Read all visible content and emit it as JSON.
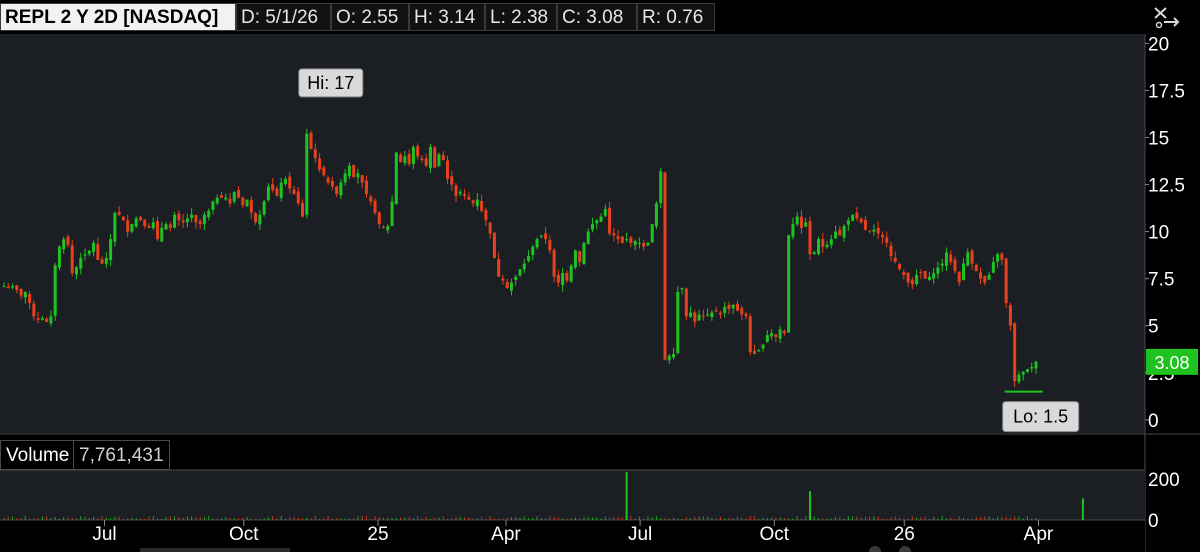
{
  "header": {
    "symbol": "REPL 2 Y 2D [NASDAQ]",
    "date": "D: 5/1/26",
    "open": "O: 2.55",
    "high": "H: 3.14",
    "low": "L: 2.38",
    "close": "C: 3.08",
    "range": "R: 0.76",
    "tool_icon": "scissors-cursor-icon"
  },
  "volume_panel": {
    "label": "Volume",
    "value": "7,761,431",
    "axis_ticks": [
      "200",
      "0"
    ]
  },
  "price_tag": {
    "value": "3.08",
    "color": "#1fc31f"
  },
  "colors": {
    "up": "#1fc31f",
    "down": "#e8401c",
    "background": "#1b1f24",
    "panel_bg": "#000000"
  },
  "chart_data": {
    "type": "candlestick",
    "price_axis": {
      "ticks": [
        "20",
        "17.5",
        "15",
        "12.5",
        "10",
        "7.5",
        "5",
        "2.5",
        "0"
      ],
      "ylim": [
        -0.7,
        20.5
      ]
    },
    "time_axis": {
      "ticks": [
        "Jul",
        "Oct",
        "25",
        "Apr",
        "Jul",
        "Oct",
        "26",
        "Apr"
      ]
    },
    "annotations": [
      {
        "label": "Hi: 17",
        "value": 17
      },
      {
        "label": "Lo: 1.5",
        "value": 1.5
      }
    ],
    "last_price": 3.08,
    "close_series": [
      7.1,
      7.0,
      7.1,
      6.9,
      6.6,
      6.8,
      6.2,
      5.5,
      5.3,
      5.4,
      5.2,
      5.5,
      8.2,
      9.2,
      9.6,
      9.3,
      7.8,
      8.1,
      8.6,
      8.8,
      9.0,
      9.4,
      8.5,
      8.3,
      8.6,
      9.6,
      11.0,
      10.9,
      10.6,
      10.0,
      10.4,
      10.7,
      10.6,
      10.3,
      10.2,
      10.5,
      9.6,
      10.2,
      10.4,
      10.2,
      10.9,
      10.6,
      10.5,
      10.7,
      10.9,
      10.5,
      10.4,
      10.9,
      11.1,
      11.6,
      11.8,
      11.8,
      11.8,
      11.5,
      12.1,
      11.8,
      11.4,
      11.7,
      11.0,
      10.5,
      10.9,
      11.6,
      12.4,
      12.2,
      11.9,
      12.6,
      12.8,
      12.3,
      12.0,
      11.5,
      10.8,
      15.2,
      14.4,
      13.9,
      13.3,
      13.0,
      12.6,
      12.4,
      12.0,
      12.6,
      13.1,
      13.5,
      12.9,
      13.1,
      12.6,
      12.0,
      11.6,
      11.0,
      10.4,
      10.2,
      10.3,
      11.6,
      14.2,
      13.7,
      14.0,
      13.6,
      14.5,
      14.0,
      13.8,
      13.5,
      14.5,
      13.4,
      14.1,
      13.8,
      12.8,
      12.5,
      11.9,
      12.1,
      11.9,
      11.7,
      11.5,
      11.7,
      11.1,
      10.6,
      9.9,
      8.6,
      7.6,
      7.4,
      7.0,
      7.3,
      7.6,
      8.0,
      8.3,
      8.7,
      9.2,
      9.6,
      9.8,
      9.6,
      9.0,
      7.6,
      7.3,
      7.8,
      7.4,
      8.2,
      9.0,
      8.4,
      9.4,
      10.0,
      10.4,
      10.6,
      10.8,
      11.2,
      9.9,
      9.8,
      9.6,
      9.4,
      9.6,
      9.4,
      9.5,
      9.4,
      9.2,
      9.4,
      10.4,
      11.5,
      13.2,
      3.2,
      3.4,
      3.5,
      6.8,
      7.0,
      5.5,
      5.7,
      5.2,
      5.6,
      5.5,
      5.6,
      5.7,
      5.8,
      5.6,
      6.0,
      5.9,
      6.1,
      5.8,
      5.6,
      5.5,
      3.6,
      3.5,
      3.7,
      4.0,
      4.5,
      4.6,
      4.4,
      4.8,
      4.6,
      9.8,
      10.4,
      10.8,
      10.2,
      10.5,
      8.8,
      8.9,
      9.6,
      9.2,
      9.3,
      9.6,
      10.0,
      9.8,
      10.3,
      10.6,
      10.9,
      10.7,
      10.5,
      10.1,
      10.0,
      10.1,
      9.9,
      9.7,
      9.4,
      8.7,
      8.4,
      8.0,
      7.7,
      7.3,
      7.2,
      7.7,
      7.8,
      7.5,
      7.6,
      7.8,
      8.1,
      8.3,
      8.9,
      8.4,
      7.9,
      7.3,
      8.3,
      8.9,
      8.3,
      7.9,
      7.5,
      7.3,
      7.7,
      8.4,
      8.8,
      8.5,
      6.2,
      5.0,
      2.05,
      2.4,
      2.55,
      2.7,
      2.8,
      3.08
    ],
    "volume_spikes": [
      {
        "label": "Jul",
        "relative": 1.0
      },
      {
        "label": "Oct",
        "relative": 0.6
      },
      {
        "label": "Apr",
        "relative": 0.45
      }
    ]
  }
}
